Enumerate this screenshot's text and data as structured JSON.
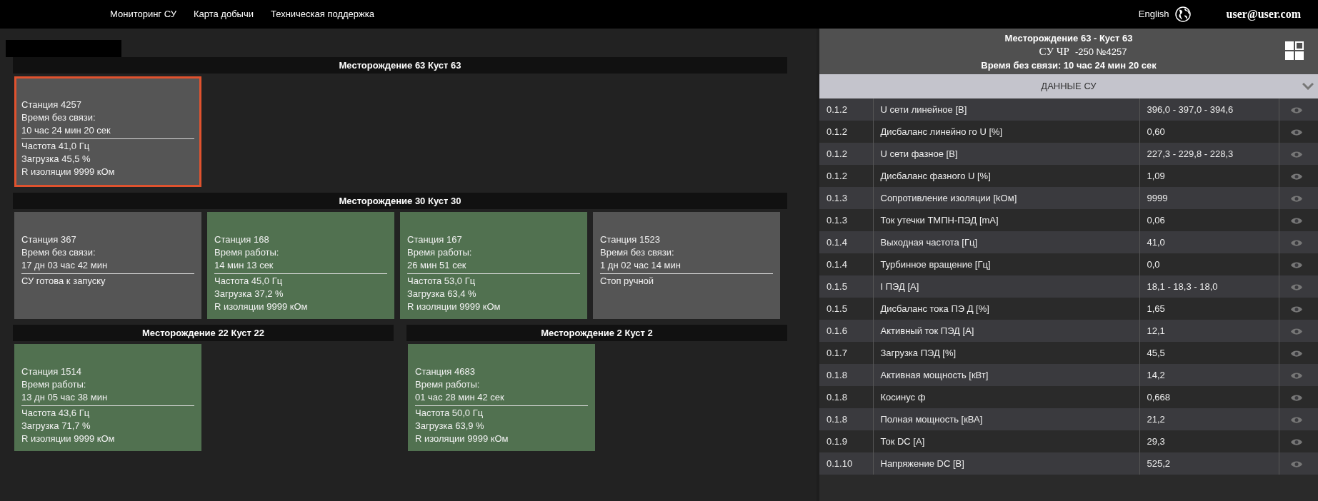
{
  "nav": {
    "links": [
      "Мониторинг СУ",
      "Карта добычи",
      "Техническая поддержка"
    ],
    "language": "English",
    "user": "user@user.com"
  },
  "group_rows": [
    [
      {
        "title": "Месторождение 63 Куст 63",
        "stations": [
          {
            "name": "Станция 4257",
            "kind": "no_link",
            "selected": true,
            "time_label": "Время без связи:",
            "time": "10 час 24 мин 20 сек",
            "details": [
              "Частота 41,0 Гц",
              "Загрузка 45,5 %",
              "R изоляции 9999 кОм"
            ]
          }
        ]
      }
    ],
    [
      {
        "title": "Месторождение 30 Куст 30",
        "stations": [
          {
            "name": "Станция 367",
            "kind": "no_link",
            "selected": false,
            "time_label": "Время без связи:",
            "time": "17 дн 03 час 42 мин",
            "details": [
              "СУ готова к запуску"
            ]
          },
          {
            "name": "Станция 168",
            "kind": "running",
            "selected": false,
            "time_label": "Время работы:",
            "time": "14 мин 13 сек",
            "details": [
              "Частота 45,0 Гц",
              "Загрузка 37,2 %",
              "R изоляции 9999 кОм"
            ]
          },
          {
            "name": "Станция 167",
            "kind": "running",
            "selected": false,
            "time_label": "Время работы:",
            "time": "26 мин 51 сек",
            "details": [
              "Частота 53,0 Гц",
              "Загрузка 63,4 %",
              "R изоляции 9999 кОм"
            ]
          },
          {
            "name": "Станция 1523",
            "kind": "no_link",
            "selected": false,
            "time_label": "Время без связи:",
            "time": "1 дн 02 час 14 мин",
            "details": [
              "Стоп ручной"
            ]
          }
        ]
      }
    ],
    [
      {
        "title": "Месторождение 22 Куст 22",
        "stations": [
          {
            "name": "Станция 1514",
            "kind": "running",
            "selected": false,
            "time_label": "Время работы:",
            "time": "13 дн 05 час 38 мин",
            "details": [
              "Частота 43,6 Гц",
              "Загрузка 71,7 %",
              "R изоляции 9999 кОм"
            ]
          }
        ]
      },
      {
        "title": "Месторождение 2 Куст 2",
        "stations": [
          {
            "name": "Станция 4683",
            "kind": "running",
            "selected": false,
            "time_label": "Время работы:",
            "time": "01 час 28 мин 42 сек",
            "details": [
              "Частота 50,0 Гц",
              "Загрузка 63,9 %",
              "R изоляции 9999 кОм"
            ]
          }
        ]
      }
    ]
  ],
  "detail_panel": {
    "title": "Месторождение 63 - Куст 63",
    "device_type": "СУ ЧР",
    "device_number": "-250 №4257",
    "status_line": "Время без связи: 10 час 24 мин 20 сек",
    "section": {
      "title": "ДАННЫЕ СУ",
      "expanded": true
    },
    "rows": [
      {
        "code": "0.1.2",
        "name": "U сети линейное [В]",
        "value": "396,0 - 397,0 - 394,6"
      },
      {
        "code": "0.1.2",
        "name": "Дисбаланс линейно го U [%]",
        "value": "0,60"
      },
      {
        "code": "0.1.2",
        "name": "U сети фазное [В]",
        "value": "227,3 - 229,8 - 228,3"
      },
      {
        "code": "0.1.2",
        "name": "Дисбаланс фазного U [%]",
        "value": "1,09"
      },
      {
        "code": "0.1.3",
        "name": "Сопротивление изоляции [kОм]",
        "value": "9999"
      },
      {
        "code": "0.1.3",
        "name": "Ток утечки ТМПН-ПЭД [mA]",
        "value": "0,06"
      },
      {
        "code": "0.1.4",
        "name": "Выходная частота [Гц]",
        "value": "41,0"
      },
      {
        "code": "0.1.4",
        "name": "Турбинное вращение [Гц]",
        "value": "0,0"
      },
      {
        "code": "0.1.5",
        "name": "I ПЭД [А]",
        "value": "18,1 - 18,3 - 18,0"
      },
      {
        "code": "0.1.5",
        "name": "Дисбаланс тока ПЭ Д [%]",
        "value": "1,65"
      },
      {
        "code": "0.1.6",
        "name": "Активный ток ПЭД [А]",
        "value": "12,1"
      },
      {
        "code": "0.1.7",
        "name": "Загрузка ПЭД [%]",
        "value": "45,5"
      },
      {
        "code": "0.1.8",
        "name": "Активная мощность [кВт]",
        "value": "14,2"
      },
      {
        "code": "0.1.8",
        "name": "Косинус ф",
        "value": "0,668"
      },
      {
        "code": "0.1.8",
        "name": "Полная мощность [кВА]",
        "value": "21,2"
      },
      {
        "code": "0.1.9",
        "name": "Ток DC [А]",
        "value": "29,3"
      },
      {
        "code": "0.1.10",
        "name": "Напряжение DC [В]",
        "value": "525,2"
      }
    ]
  }
}
